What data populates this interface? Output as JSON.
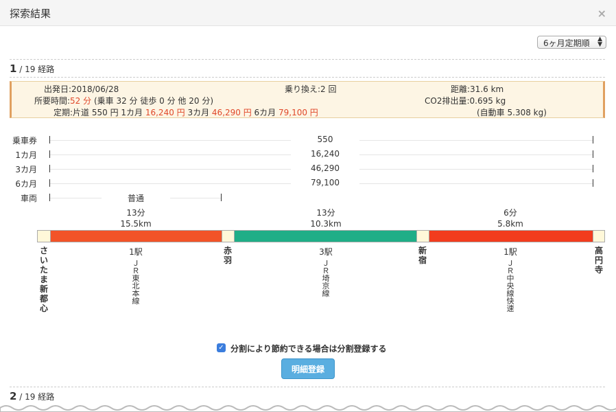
{
  "modal": {
    "title": "探索結果",
    "close": "×"
  },
  "sort": {
    "selected": "6ヶ月定期順",
    "arrow": "▲▼"
  },
  "route1": {
    "index": "1",
    "total": " / 19 経路"
  },
  "route2": {
    "index": "2",
    "total": " / 19 経路"
  },
  "info": {
    "date": "出発日:2018/06/28",
    "transfers": "乗り換え:2 回",
    "distance": "距離:31.6 km",
    "time_label": "所要時間:",
    "time_value": "52 分",
    "time_detail": " (乗車 32 分 徒歩 0 分 他 20 分)",
    "co2": "CO2排出量:0.695 kg",
    "pass_prefix": "定期:片道 550 円 1カ月 ",
    "pass_1m": "16,240 円",
    "pass_3m_label": " 3カ月 ",
    "pass_3m": "46,290 円",
    "pass_6m_label": " 6カ月 ",
    "pass_6m": "79,100 円",
    "car": "(自動車 5.308 kg)"
  },
  "fares": [
    {
      "label": "乗車券",
      "value": "550"
    },
    {
      "label": "1カ月",
      "value": "16,240"
    },
    {
      "label": "3カ月",
      "value": "46,290"
    },
    {
      "label": "6カ月",
      "value": "79,100"
    },
    {
      "label": "車両",
      "value": "普通"
    }
  ],
  "segments": [
    {
      "time": "13分",
      "dist": "15.5km",
      "stops": "1駅",
      "line": "ＪＲ東北本線",
      "color": "#f25328"
    },
    {
      "time": "13分",
      "dist": "10.3km",
      "stops": "3駅",
      "line": "ＪＲ埼京線",
      "color": "#1fae87"
    },
    {
      "time": "6分",
      "dist": "5.8km",
      "stops": "1駅",
      "line": "ＪＲ中央線快速",
      "color": "#f23c1e"
    }
  ],
  "stations": [
    "さいたま新都心",
    "赤羽",
    "新宿",
    "高円寺"
  ],
  "split": {
    "checked": "✓",
    "label": "分割により節約できる場合は分割登録する"
  },
  "register_button": "明細登録"
}
